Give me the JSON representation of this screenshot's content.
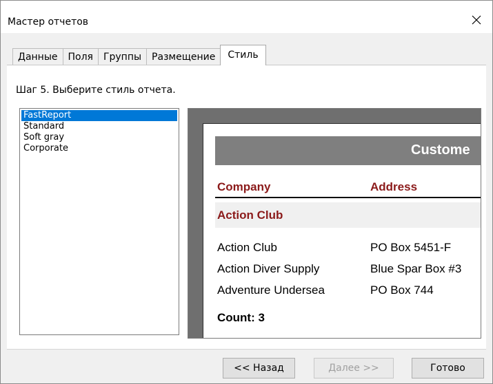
{
  "window": {
    "title": "Мастер отчетов"
  },
  "tabs": [
    "Данные",
    "Поля",
    "Группы",
    "Размещение",
    "Стиль"
  ],
  "step_text": "Шаг 5. Выберите стиль отчета.",
  "styles": [
    "FastReport",
    "Standard",
    "Soft gray",
    "Corporate"
  ],
  "selected_style": "FastReport",
  "preview": {
    "title": "Custome",
    "col_company": "Company",
    "col_address": "Address",
    "group": "Action Club",
    "rows": [
      {
        "company": "Action Club",
        "address": "PO Box 5451-F"
      },
      {
        "company": "Action Diver Supply",
        "address": "Blue Spar Box #3"
      },
      {
        "company": "Adventure Undersea",
        "address": "PO Box 744"
      }
    ],
    "count": "Count: 3"
  },
  "buttons": {
    "back": "<< Назад",
    "next": "Далее >>",
    "finish": "Готово"
  },
  "colors": {
    "selection": "#0078d7",
    "header_text": "#8b1a1a",
    "title_band": "#7f7f7f"
  },
  "icons": {
    "close": "close-icon"
  }
}
